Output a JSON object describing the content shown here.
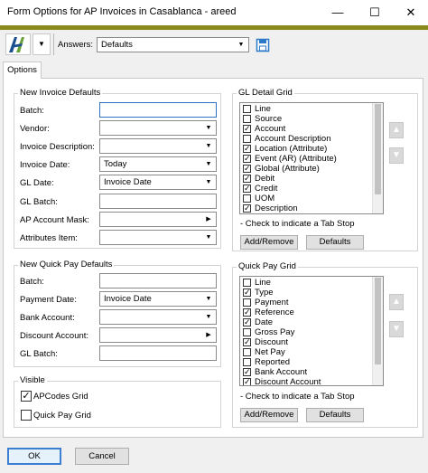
{
  "window": {
    "title": "Form Options for AP Invoices in Casablanca - areed",
    "minimize_glyph": "—",
    "maximize_glyph": "☐",
    "close_glyph": "✕"
  },
  "toolbar": {
    "answers_label": "Answers:",
    "answers_value": "Defaults",
    "logo_icon": "company-logo-icon",
    "save_icon": "save-icon"
  },
  "tabs": [
    "Options"
  ],
  "new_invoice_defaults": {
    "title": "New Invoice Defaults",
    "fields": [
      {
        "label": "Batch:",
        "value": "",
        "kind": "text"
      },
      {
        "label": "Vendor:",
        "value": "",
        "kind": "dropdown"
      },
      {
        "label": "Invoice Description:",
        "value": "",
        "kind": "dropdown"
      },
      {
        "label": "Invoice Date:",
        "value": "Today",
        "kind": "dropdown"
      },
      {
        "label": "GL Date:",
        "value": "Invoice Date",
        "kind": "dropdown"
      },
      {
        "label": "GL Batch:",
        "value": "",
        "kind": "text"
      },
      {
        "label": "AP Account Mask:",
        "value": "",
        "kind": "picker"
      },
      {
        "label": "Attributes Item:",
        "value": "",
        "kind": "dropdown"
      }
    ]
  },
  "new_quick_pay_defaults": {
    "title": "New Quick Pay Defaults",
    "fields": [
      {
        "label": "Batch:",
        "value": "",
        "kind": "text"
      },
      {
        "label": "Payment Date:",
        "value": "Invoice Date",
        "kind": "dropdown"
      },
      {
        "label": "Bank Account:",
        "value": "",
        "kind": "dropdown"
      },
      {
        "label": "Discount Account:",
        "value": "",
        "kind": "picker"
      },
      {
        "label": "GL Batch:",
        "value": "",
        "kind": "text"
      }
    ]
  },
  "visible": {
    "title": "Visible",
    "items": [
      {
        "label": "APCodes Grid",
        "checked": true
      },
      {
        "label": "Quick Pay Grid",
        "checked": false
      }
    ]
  },
  "gl_detail_grid": {
    "title": "GL Detail Grid",
    "items": [
      {
        "label": "Line",
        "checked": false
      },
      {
        "label": "Source",
        "checked": false
      },
      {
        "label": "Account",
        "checked": true
      },
      {
        "label": "Account Description",
        "checked": false
      },
      {
        "label": "Location (Attribute)",
        "checked": true
      },
      {
        "label": "Event (AR) (Attribute)",
        "checked": true
      },
      {
        "label": "Global (Attribute)",
        "checked": true
      },
      {
        "label": "Debit",
        "checked": true
      },
      {
        "label": "Credit",
        "checked": true
      },
      {
        "label": "UOM",
        "checked": false
      },
      {
        "label": "Description",
        "checked": true
      }
    ],
    "hint": "- Check to indicate a Tab Stop",
    "add_remove": "Add/Remove",
    "defaults": "Defaults"
  },
  "quick_pay_grid": {
    "title": "Quick Pay Grid",
    "items": [
      {
        "label": "Line",
        "checked": false
      },
      {
        "label": "Type",
        "checked": true
      },
      {
        "label": "Payment",
        "checked": false
      },
      {
        "label": "Reference",
        "checked": true
      },
      {
        "label": "Date",
        "checked": true
      },
      {
        "label": "Gross Pay",
        "checked": false
      },
      {
        "label": "Discount",
        "checked": true
      },
      {
        "label": "Net Pay",
        "checked": false
      },
      {
        "label": "Reported",
        "checked": false
      },
      {
        "label": "Bank Account",
        "checked": true
      },
      {
        "label": "Discount Account",
        "checked": true
      }
    ],
    "hint": "- Check to indicate a Tab Stop",
    "add_remove": "Add/Remove",
    "defaults": "Defaults"
  },
  "footer": {
    "ok": "OK",
    "cancel": "Cancel"
  }
}
